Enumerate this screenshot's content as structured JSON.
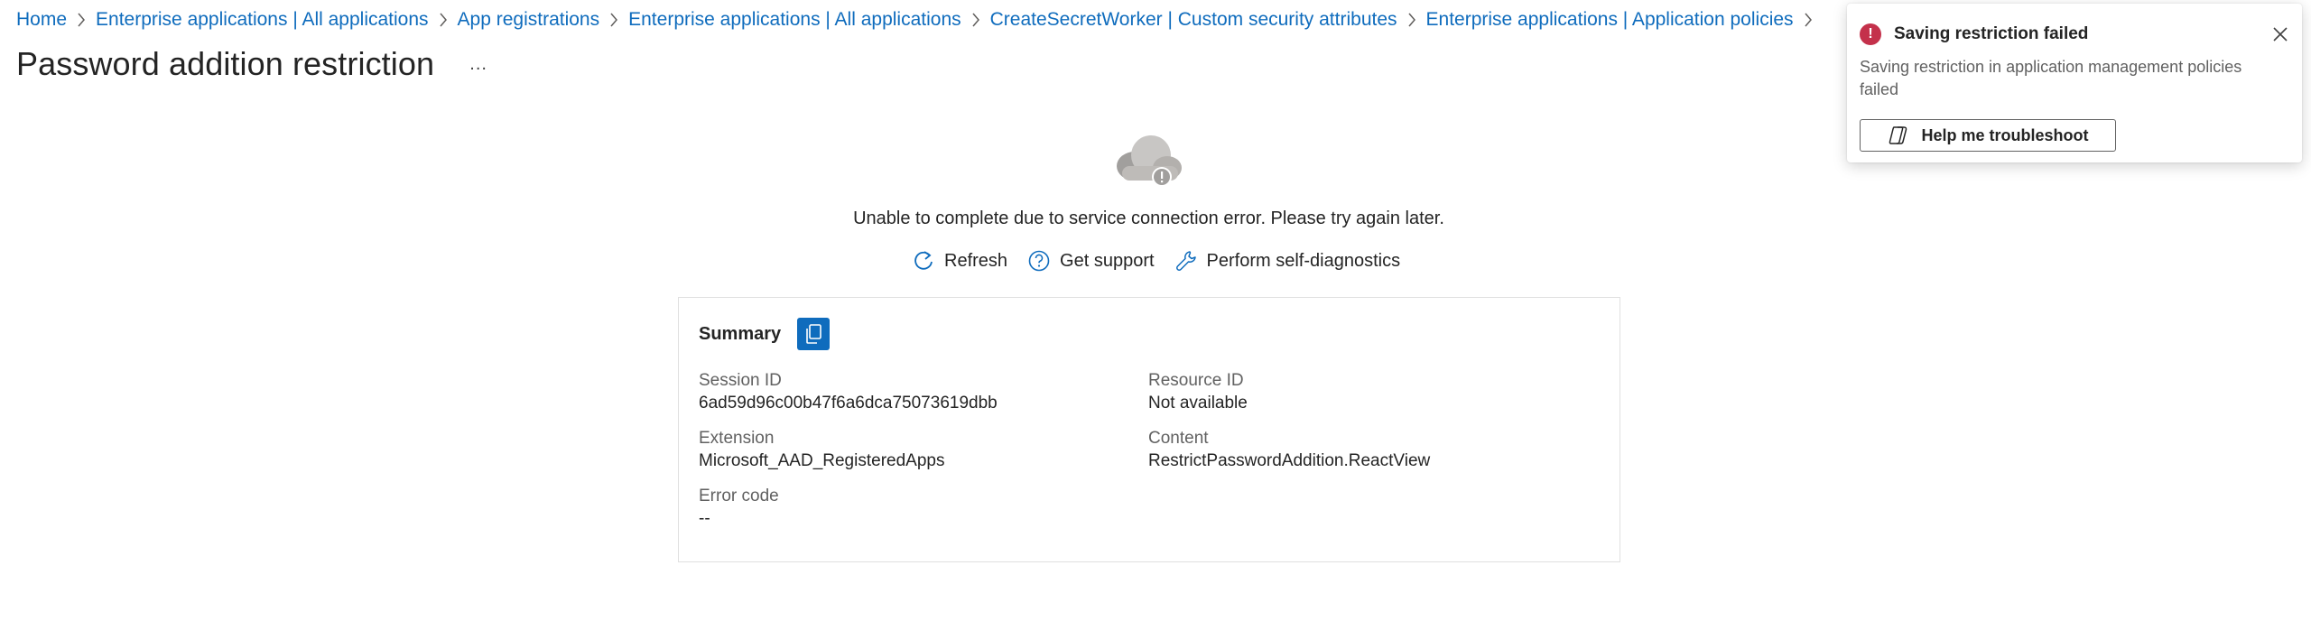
{
  "breadcrumb": [
    {
      "label": "Home"
    },
    {
      "label": "Enterprise applications | All applications"
    },
    {
      "label": "App registrations"
    },
    {
      "label": "Enterprise applications | All applications"
    },
    {
      "label": "CreateSecretWorker | Custom security attributes"
    },
    {
      "label": "Enterprise applications | Application policies"
    }
  ],
  "page": {
    "title": "Password addition restriction",
    "more_label": "..."
  },
  "error": {
    "message": "Unable to complete due to service connection error. Please try again later.",
    "actions": {
      "refresh": "Refresh",
      "support": "Get support",
      "diagnostics": "Perform self-diagnostics"
    }
  },
  "summary": {
    "title": "Summary",
    "session_id_label": "Session ID",
    "session_id_value": "6ad59d96c00b47f6a6dca75073619dbb",
    "resource_id_label": "Resource ID",
    "resource_id_value": "Not available",
    "extension_label": "Extension",
    "extension_value": "Microsoft_AAD_RegisteredApps",
    "content_label": "Content",
    "content_value": "RestrictPasswordAddition.ReactView",
    "error_code_label": "Error code",
    "error_code_value": "--"
  },
  "toast": {
    "title": "Saving restriction failed",
    "body": "Saving restriction in application management policies failed",
    "button_label": "Help me troubleshoot",
    "error_symbol": "!"
  },
  "colors": {
    "link": "#0f6cbd",
    "error": "#c4314b",
    "accent": "#0f6cbd"
  },
  "icons": {
    "cloud": "cloud-error-icon",
    "refresh": "refresh-icon",
    "support": "question-circle-icon",
    "diagnostics": "wrench-icon",
    "copy": "copy-icon",
    "close": "close-icon",
    "copilot": "copilot-icon"
  }
}
